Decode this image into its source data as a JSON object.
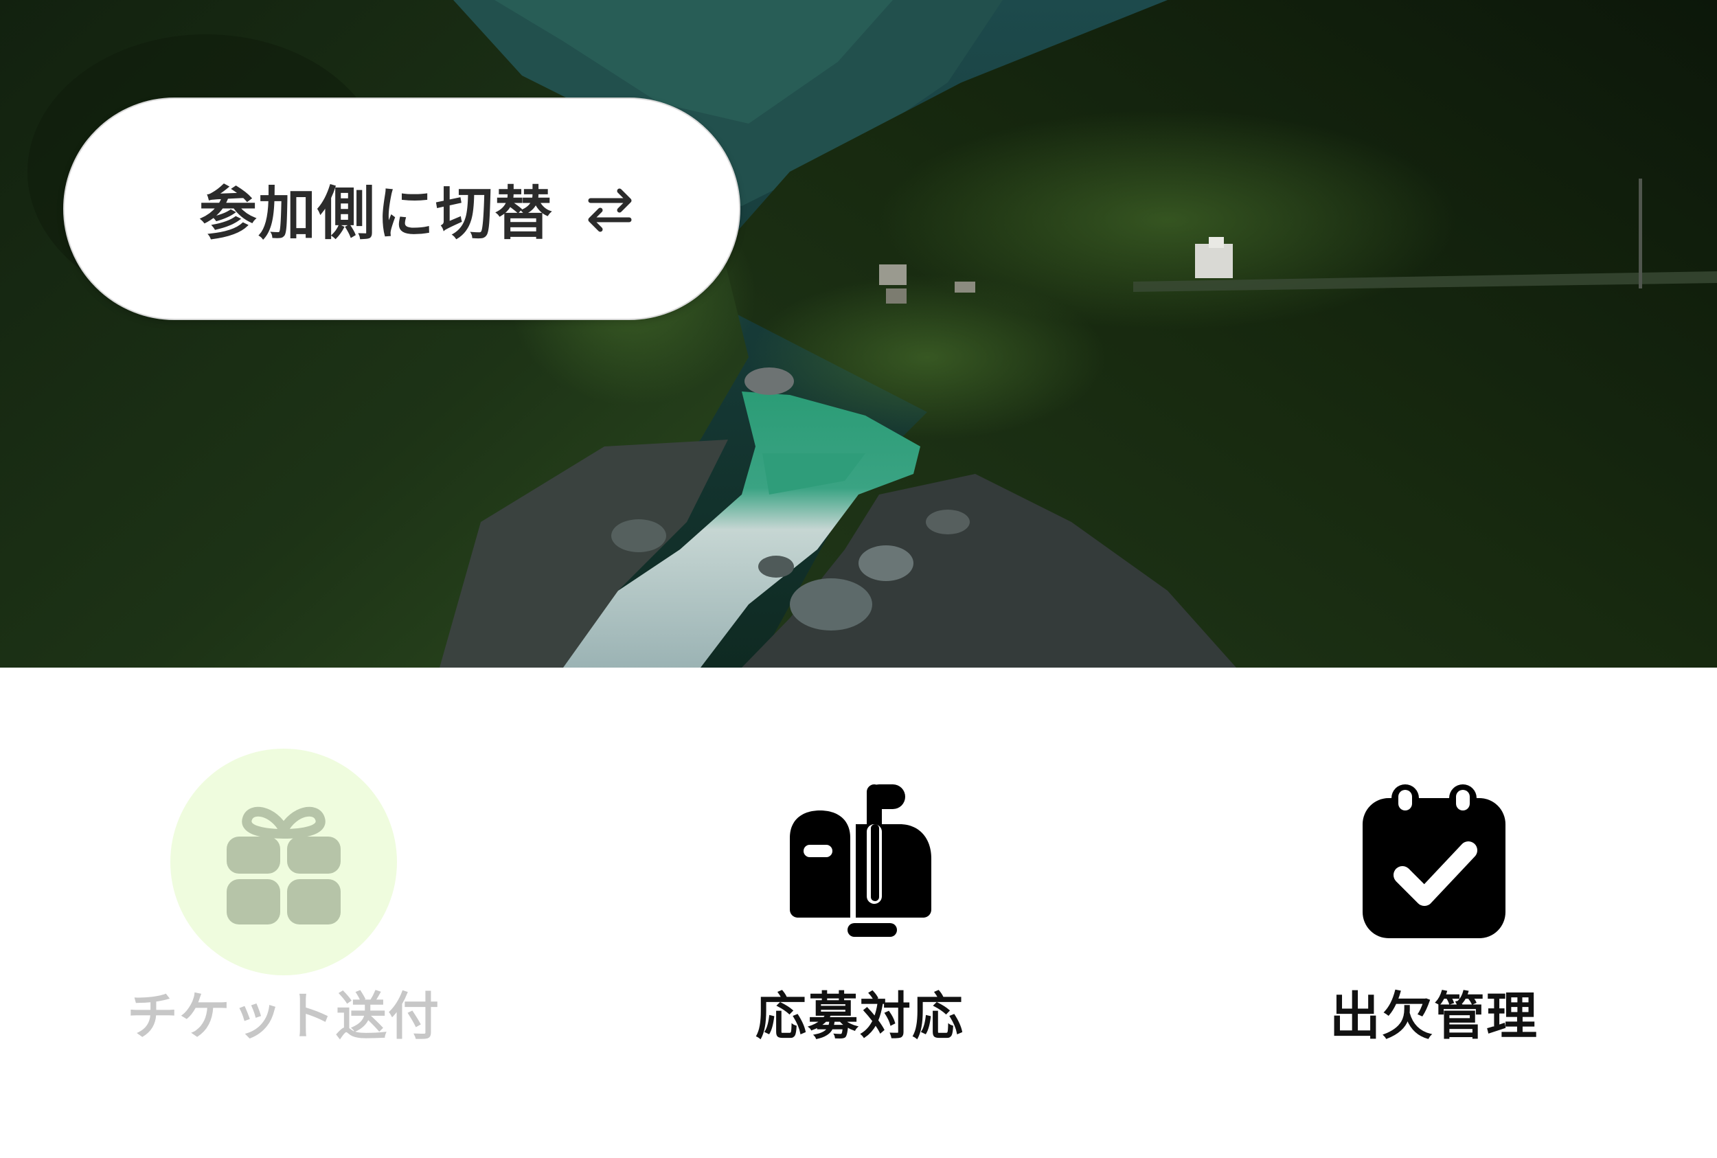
{
  "switch_button": {
    "label": "参加側に切替",
    "icon": "swap-arrows-icon"
  },
  "actions": [
    {
      "label": "チケット送付",
      "icon": "gift-icon",
      "state": "disabled"
    },
    {
      "label": "応募対応",
      "icon": "mailbox-icon",
      "state": "active"
    },
    {
      "label": "出欠管理",
      "icon": "calendar-check-icon",
      "state": "active"
    }
  ],
  "colors": {
    "switch_text": "#2b2b2b",
    "disabled_text": "#c7c7c7",
    "active_text": "#111111",
    "disabled_icon": "#b6c4a8",
    "highlight_circle": "#effcde",
    "active_icon": "#000000"
  }
}
